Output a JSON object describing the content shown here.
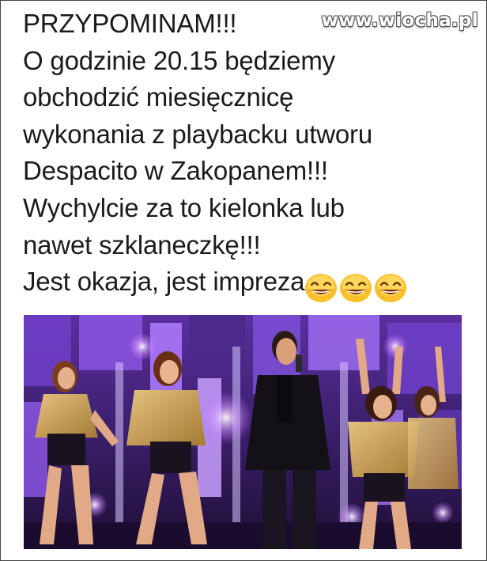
{
  "watermark": {
    "text": "www.wiocha.pl"
  },
  "post": {
    "lines": [
      "PRZYPOMINAM!!!",
      "O godzinie 20.15 będziemy",
      "obchodzić miesięcznicę",
      "wykonania z playbacku utworu",
      "Despacito w Zakopanem!!!",
      "Wychylcie za to kielonka lub",
      "nawet szklaneczkę!!!",
      "Jest okazja, jest impreza"
    ],
    "emoji": [
      "grinning-face-emoji",
      "grinning-face-emoji",
      "grinning-face-emoji"
    ]
  },
  "photo": {
    "subject": "stage-performance-photo",
    "colors": {
      "stage_background": "#3b1f6b",
      "lights": "#c46bff",
      "gold_fringe": "#c9a35a"
    }
  }
}
